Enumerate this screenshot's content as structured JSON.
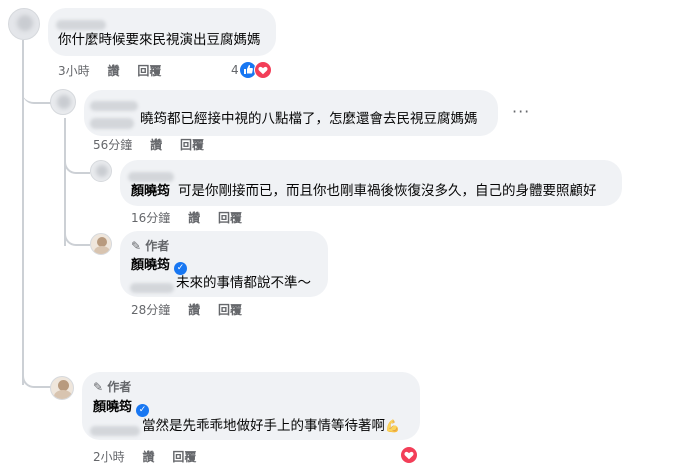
{
  "comment_main": {
    "text": "你什麼時候要來民視演出豆腐媽媽",
    "time": "3小時",
    "like_label": "讚",
    "reply_label": "回覆",
    "reaction_count": "4",
    "like_icon": "thumbs-up-icon",
    "heart_icon": "heart-icon"
  },
  "reply1": {
    "text": "曉筠都已經接中視的八點檔了，怎麼還會去民視豆腐媽媽",
    "time": "56分鐘",
    "like_label": "讚",
    "reply_label": "回覆",
    "more_label": "···"
  },
  "reply2": {
    "author_name": "顏曉筠",
    "text": "可是你剛接而已，而且你也剛車禍後恢復沒多久，自己的身體要照顧好",
    "time": "16分鐘",
    "like_label": "讚",
    "reply_label": "回覆"
  },
  "reply3": {
    "author_badge": "作者",
    "author_name": "顏曉筠",
    "text": "未來的事情都說不準～",
    "time": "28分鐘",
    "like_label": "讚",
    "reply_label": "回覆"
  },
  "reply4": {
    "author_badge": "作者",
    "author_name": "顏曉筠",
    "text": "當然是先乖乖地做好手上的事情等待著啊",
    "emoji": "💪",
    "time": "2小時",
    "like_label": "讚",
    "reply_label": "回覆",
    "heart_icon": "heart-icon"
  },
  "colors": {
    "bubble": "#f0f2f5",
    "meta_text": "#65676b",
    "like_blue": "#1877f2",
    "heart_red": "#f33e58",
    "thread_line": "#ccd0d5"
  }
}
